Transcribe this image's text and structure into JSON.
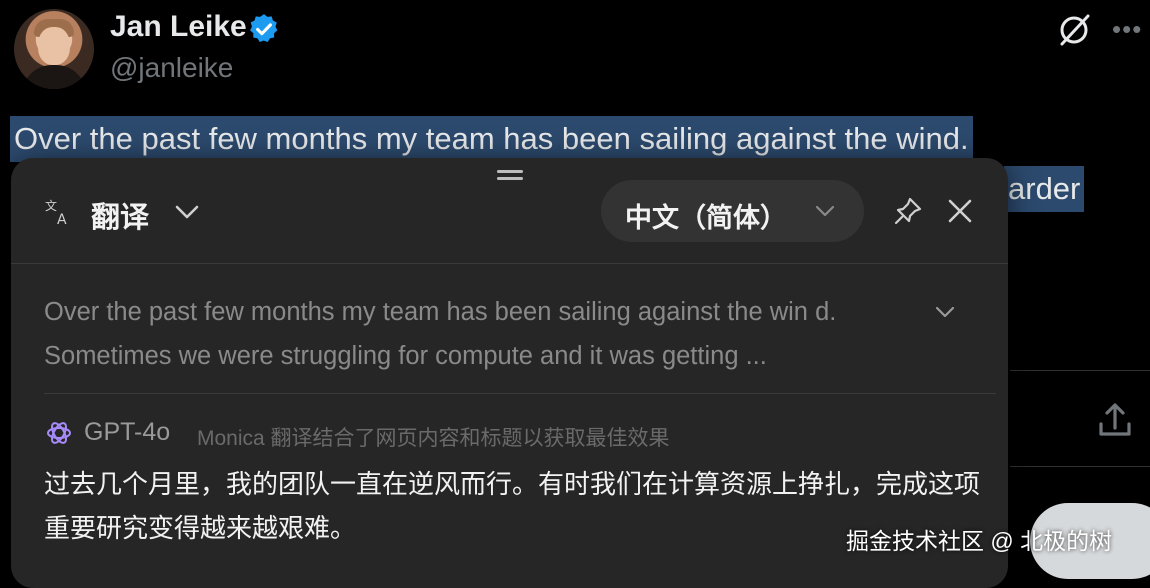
{
  "author": {
    "display_name": "Jan Leike",
    "handle": "@janleike"
  },
  "tweet": {
    "line1": "Over the past few months my team has been sailing against the wind.",
    "line2_tail": "arder"
  },
  "translator": {
    "title": "翻译",
    "target_language": "中文（简体）",
    "source_text": "Over the past few months my team has been sailing against the win d. Sometimes we were struggling for compute and it was getting ...",
    "model_name": "GPT-4o",
    "model_note": "Monica 翻译结合了网页内容和标题以获取最佳效果",
    "result_text": "过去几个月里，我的团队一直在逆风而行。有时我们在计算资源上挣扎，完成这项重要研究变得越来越艰难。"
  },
  "watermark": "掘金技术社区 @ 北极的树",
  "colors": {
    "background": "#000000",
    "highlight": "#2c4a6e",
    "panel": "#262626",
    "verified": "#1d9bf0",
    "gpt_icon": "#a78bfa"
  },
  "icons": [
    "verified-badge-icon",
    "grok-off-icon",
    "more-icon",
    "share-icon",
    "translate-icon",
    "chevron-down-icon",
    "pin-icon",
    "close-icon",
    "gpt-icon"
  ]
}
